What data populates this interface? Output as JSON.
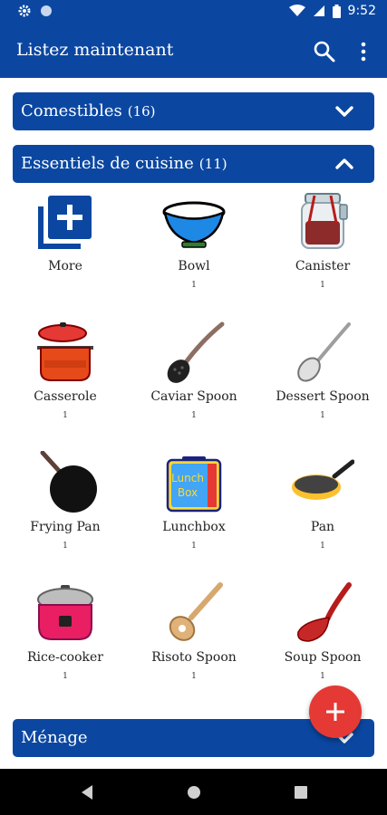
{
  "status": {
    "time": "9:52"
  },
  "app_bar": {
    "title": "Listez maintenant",
    "search_icon": "search-icon",
    "more_icon": "more-vert-icon"
  },
  "categories": [
    {
      "name": "Comestibles",
      "count": "(16)",
      "expanded": false
    },
    {
      "name": "Essentiels de cuisine",
      "count": "(11)",
      "expanded": true
    },
    {
      "name": "Ménage",
      "count": "",
      "expanded": false
    }
  ],
  "items": [
    {
      "name": "More",
      "qty": "",
      "icon": "add-box-icon"
    },
    {
      "name": "Bowl",
      "qty": "1",
      "icon": "bowl-icon"
    },
    {
      "name": "Canister",
      "qty": "1",
      "icon": "canister-icon"
    },
    {
      "name": "Casserole",
      "qty": "1",
      "icon": "casserole-icon"
    },
    {
      "name": "Caviar Spoon",
      "qty": "1",
      "icon": "caviar-spoon-icon"
    },
    {
      "name": "Dessert Spoon",
      "qty": "1",
      "icon": "dessert-spoon-icon"
    },
    {
      "name": "Frying Pan",
      "qty": "1",
      "icon": "frying-pan-icon"
    },
    {
      "name": "Lunchbox",
      "qty": "1",
      "icon": "lunchbox-icon"
    },
    {
      "name": "Pan",
      "qty": "1",
      "icon": "pan-icon"
    },
    {
      "name": "Rice-cooker",
      "qty": "1",
      "icon": "rice-cooker-icon"
    },
    {
      "name": "Risoto Spoon",
      "qty": "1",
      "icon": "risoto-spoon-icon"
    },
    {
      "name": "Soup Spoon",
      "qty": "1",
      "icon": "soup-spoon-icon"
    }
  ],
  "fab": {
    "icon": "add-icon"
  },
  "colors": {
    "primary": "#0b47a1",
    "fab": "#e53935"
  }
}
